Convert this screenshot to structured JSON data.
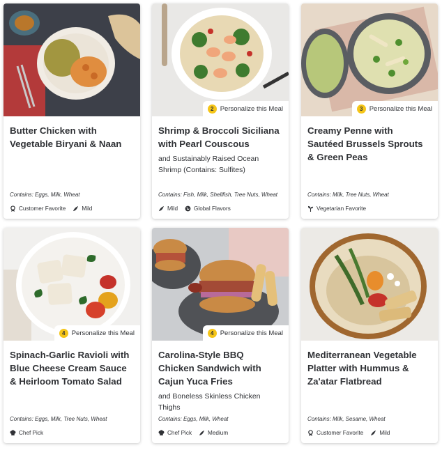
{
  "meals": [
    {
      "title": "Butter Chicken with Vegetable Biryani & Naan",
      "subtitle": "",
      "personalize": null,
      "contains": "Contains: Eggs, Milk, Wheat",
      "tags": [
        {
          "icon": "ribbon-icon",
          "label": "Customer Favorite"
        },
        {
          "icon": "chili-pepper-icon",
          "label": "Mild"
        }
      ]
    },
    {
      "title": "Shrimp & Broccoli Siciliana with Pearl Couscous",
      "subtitle": "and Sustainably Raised Ocean Shrimp (Contains: Sulfites)",
      "personalize": {
        "count": "2",
        "label": "Personalize this Meal"
      },
      "contains": "Contains: Fish, Milk, Shellfish, Tree Nuts, Wheat",
      "tags": [
        {
          "icon": "chili-pepper-icon",
          "label": "Mild"
        },
        {
          "icon": "globe-icon",
          "label": "Global Flavors"
        }
      ]
    },
    {
      "title": "Creamy Penne with Sautéed Brussels Sprouts & Green Peas",
      "subtitle": "",
      "personalize": {
        "count": "3",
        "label": "Personalize this Meal"
      },
      "contains": "Contains: Milk, Tree Nuts, Wheat",
      "tags": [
        {
          "icon": "sprout-icon",
          "label": "Vegetarian Favorite"
        }
      ]
    },
    {
      "title": "Spinach-Garlic Ravioli with Blue Cheese Cream Sauce & Heirloom Tomato Salad",
      "subtitle": "",
      "personalize": {
        "count": "4",
        "label": "Personalize this Meal"
      },
      "contains": "Contains: Eggs, Milk, Tree Nuts, Wheat",
      "tags": [
        {
          "icon": "chef-hat-icon",
          "label": "Chef Pick"
        }
      ]
    },
    {
      "title": "Carolina-Style BBQ Chicken Sandwich with Cajun Yuca Fries",
      "subtitle": "and Boneless Skinless Chicken Thighs",
      "personalize": {
        "count": "4",
        "label": "Personalize this Meal"
      },
      "contains": "Contains: Eggs, Milk, Wheat",
      "tags": [
        {
          "icon": "chef-hat-icon",
          "label": "Chef Pick"
        },
        {
          "icon": "chili-pepper-icon",
          "label": "Medium"
        }
      ]
    },
    {
      "title": "Mediterranean Vegetable Platter with Hummus & Za'atar Flatbread",
      "subtitle": "",
      "personalize": null,
      "contains": "Contains: Milk, Sesame, Wheat",
      "tags": [
        {
          "icon": "ribbon-icon",
          "label": "Customer Favorite"
        },
        {
          "icon": "chili-pepper-icon",
          "label": "Mild"
        }
      ]
    }
  ],
  "colors": {
    "text": "#303236",
    "badge_yellow": "#f5c518",
    "card_bg": "#ffffff"
  }
}
